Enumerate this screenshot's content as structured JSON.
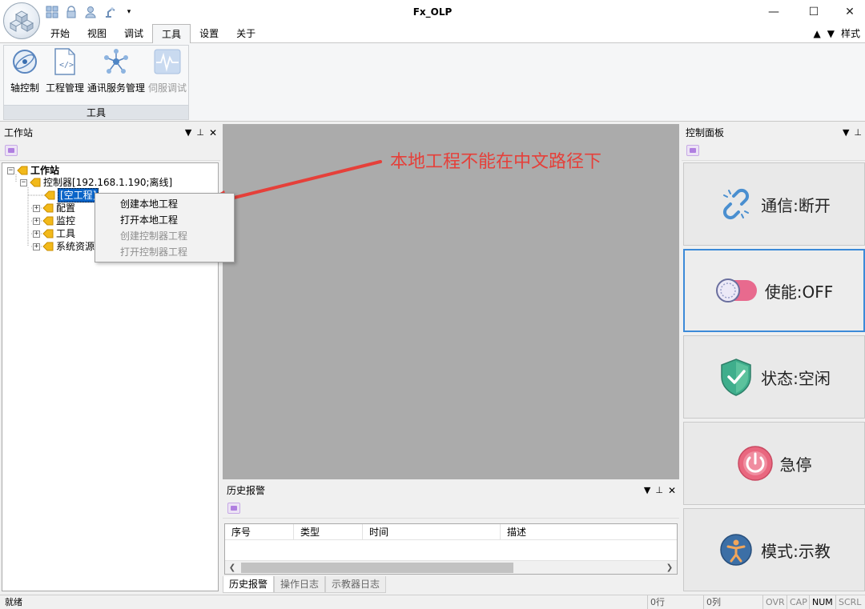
{
  "window": {
    "title": "Fx_OLP",
    "minimize_glyph": "—",
    "maximize_glyph": "☐",
    "close_glyph": "✕"
  },
  "menu": {
    "tabs": [
      {
        "label": "开始"
      },
      {
        "label": "视图"
      },
      {
        "label": "调试"
      },
      {
        "label": "工具",
        "active": true
      },
      {
        "label": "设置"
      },
      {
        "label": "关于"
      }
    ],
    "style_label": "样式",
    "up_glyph": "▲",
    "down_glyph": "▼"
  },
  "ribbon": {
    "group_label": "工具",
    "buttons": [
      {
        "label": "轴控制",
        "icon": "axis-control-icon"
      },
      {
        "label": "工程管理",
        "icon": "project-file-icon"
      },
      {
        "label": "通讯服务管理",
        "icon": "network-nodes-icon"
      },
      {
        "label": "伺服调试",
        "icon": "waveform-icon",
        "disabled": true
      }
    ]
  },
  "workstation": {
    "title": "工作站",
    "tree": {
      "root": "工作站",
      "controller": "控制器[192.168.1.190;离线]",
      "empty_project": "[空工程]",
      "config": "配置",
      "monitor": "监控",
      "tools": "工具",
      "system_resources": "系统资源"
    }
  },
  "context_menu": {
    "items": [
      {
        "label": "创建本地工程",
        "enabled": true
      },
      {
        "label": "打开本地工程",
        "enabled": true
      },
      {
        "label": "创建控制器工程",
        "enabled": false
      },
      {
        "label": "打开控制器工程",
        "enabled": false
      }
    ]
  },
  "annotation": {
    "text": "本地工程不能在中文路径下",
    "color": "#e5403a"
  },
  "alarm_panel": {
    "title": "历史报警",
    "columns": [
      "序号",
      "类型",
      "时间",
      "描述"
    ],
    "tabs": [
      {
        "label": "历史报警",
        "active": true
      },
      {
        "label": "操作日志"
      },
      {
        "label": "示教器日志"
      }
    ]
  },
  "control_panel": {
    "title": "控制面板",
    "buttons": [
      {
        "label": "通信:断开",
        "icon": "broken-link-icon"
      },
      {
        "label": "使能:OFF",
        "icon": "toggle-off-icon"
      },
      {
        "label": "状态:空闲",
        "icon": "shield-check-icon"
      },
      {
        "label": "急停",
        "icon": "power-icon"
      },
      {
        "label": "模式:示教",
        "icon": "person-icon"
      }
    ]
  },
  "statusbar": {
    "ready": "就绪",
    "row": "0行",
    "col": "0列",
    "keys": [
      {
        "label": "OVR",
        "on": false
      },
      {
        "label": "CAP",
        "on": false
      },
      {
        "label": "NUM",
        "on": true
      },
      {
        "label": "SCRL",
        "on": false
      }
    ]
  },
  "colors": {
    "accent": "#0a64c8",
    "annotation": "#e5403a",
    "workspace_bg": "#ababab"
  }
}
